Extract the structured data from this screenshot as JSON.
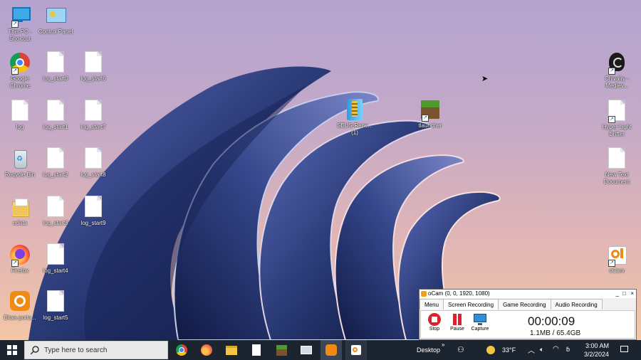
{
  "desktop": {
    "icons": [
      {
        "label": "This PC - Shortcut",
        "icon": "this-pc-icon"
      },
      {
        "label": "Control Panel",
        "icon": "control-panel-icon"
      },
      {
        "label": "Google Chrome",
        "icon": "chrome-icon"
      },
      {
        "label": "log_start0",
        "icon": "text-file-icon"
      },
      {
        "label": "log_start6",
        "icon": "text-file-icon"
      },
      {
        "label": "log",
        "icon": "text-file-icon"
      },
      {
        "label": "log_start1",
        "icon": "text-file-icon"
      },
      {
        "label": "log_start7",
        "icon": "text-file-icon"
      },
      {
        "label": "Recycle Bin",
        "icon": "recycle-bin-icon"
      },
      {
        "label": "log_start2",
        "icon": "text-file-icon"
      },
      {
        "label": "log_start8",
        "icon": "text-file-icon"
      },
      {
        "label": "edata",
        "icon": "folder-icon"
      },
      {
        "label": "log_start3",
        "icon": "text-file-icon"
      },
      {
        "label": "log_start9",
        "icon": "text-file-icon"
      },
      {
        "label": "Firefox",
        "icon": "firefox-icon"
      },
      {
        "label": "log_start4",
        "icon": "text-file-icon"
      },
      {
        "label": "Eitaa-porta...",
        "icon": "eitaa-icon"
      },
      {
        "label": "log_start5",
        "icon": "text-file-icon"
      },
      {
        "label": "SEUS-Rene... (1)",
        "icon": "zip-archive-icon"
      },
      {
        "label": "tlauncher",
        "icon": "minecraft-icon"
      },
      {
        "label": "Chivalry - Mediev...",
        "icon": "chivalry-icon"
      },
      {
        "label": "Hyper Light Drifter",
        "icon": "text-file-icon"
      },
      {
        "label": "New Text Document",
        "icon": "text-file-icon"
      },
      {
        "label": "oCam",
        "icon": "ocam-icon"
      }
    ]
  },
  "ocam": {
    "title": "oCam (0, 0, 1920, 1080)",
    "controls": [
      "_",
      "□",
      "×"
    ],
    "tabs": [
      "Menu",
      "Screen Recording",
      "Game Recording",
      "Audio Recording"
    ],
    "active_tab": "Screen Recording",
    "buttons": [
      "Stop",
      "Pause",
      "Capture"
    ],
    "timer": "00:00:09",
    "size": "1.1MB / 65.4GB"
  },
  "taskbar": {
    "search_placeholder": "Type here to search",
    "desktop_label": "Desktop",
    "weather": "33°F",
    "time": "3:00 AM",
    "date": "3/2/2024",
    "pinned": [
      "chrome-icon",
      "firefox-icon",
      "file-explorer-icon",
      "notepad-icon",
      "minecraft-icon",
      "photos-icon",
      "eitaa-icon",
      "ocam-icon"
    ]
  },
  "colors": {
    "taskbar": "#1c2430",
    "ocam_stop": "#d9232a",
    "ocam_pause": "#d9232a",
    "eitaa": "#f08a14"
  }
}
